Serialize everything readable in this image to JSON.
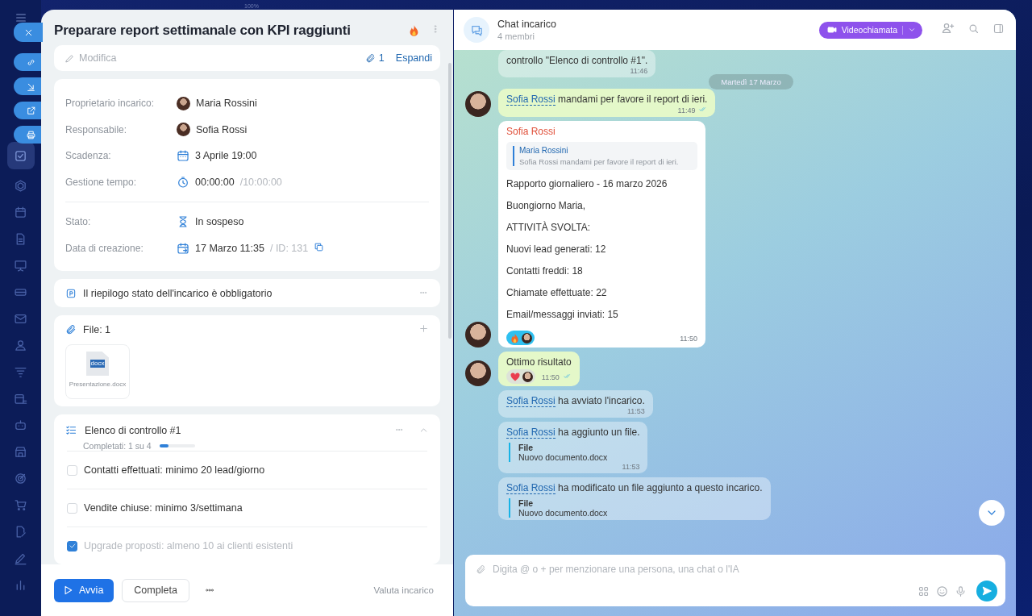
{
  "zoom_label": "100%",
  "sidebar_items": [
    {
      "kind": "tasks",
      "selected": true
    },
    {
      "kind": "hex",
      "selected": false
    },
    {
      "kind": "calendar",
      "selected": false
    },
    {
      "kind": "file",
      "selected": false
    },
    {
      "kind": "board",
      "selected": false
    },
    {
      "kind": "drive",
      "selected": false
    },
    {
      "kind": "mail",
      "selected": false
    },
    {
      "kind": "people",
      "selected": false
    },
    {
      "kind": "filter",
      "selected": false
    },
    {
      "kind": "planner",
      "selected": false
    },
    {
      "kind": "robot",
      "selected": false
    },
    {
      "kind": "store",
      "selected": false
    },
    {
      "kind": "target",
      "selected": false
    },
    {
      "kind": "cart",
      "selected": false
    },
    {
      "kind": "sign",
      "selected": false
    },
    {
      "kind": "pen",
      "selected": false
    },
    {
      "kind": "chart",
      "selected": false
    }
  ],
  "quick_actions": [
    {
      "kind": "close"
    },
    {
      "kind": "link"
    },
    {
      "kind": "download"
    },
    {
      "kind": "open"
    },
    {
      "kind": "print"
    }
  ],
  "task": {
    "title": "Preparare report settimanale con KPI raggiunti",
    "edit_label": "Modifica",
    "attachments_count": "1",
    "expand_label": "Espandi"
  },
  "details": {
    "primary": [
      {
        "kind": "person",
        "label": "Proprietario incarico:",
        "value": "Maria Rossini"
      },
      {
        "kind": "person",
        "label": "Responsabile:",
        "value": "Sofia Rossi"
      },
      {
        "kind": "date",
        "label": "Scadenza:",
        "value": "3 Aprile 19:00"
      },
      {
        "kind": "timer",
        "label": "Gestione tempo:",
        "value": "00:00:00",
        "extra": "/10:00:00"
      }
    ],
    "secondary": [
      {
        "kind": "status",
        "label": "Stato:",
        "value": "In sospeso"
      },
      {
        "kind": "created",
        "label": "Data di creazione:",
        "value": "17 Marzo 11:35",
        "extra": "/ ID: 131"
      }
    ]
  },
  "summary": {
    "text": "Il riepilogo stato dell'incarico è obbligatorio"
  },
  "files": {
    "title": "File: 1",
    "items": [
      {
        "name": "Presentazione.docx",
        "ext": "docx"
      }
    ]
  },
  "checklist": {
    "title": "Elenco di controllo #1",
    "progress_text": "Completati: 1 su 4",
    "level": 0.25,
    "expanded": true,
    "items": [
      {
        "text": "Contatti effettuati: minimo 20 lead/giorno",
        "checked": false
      },
      {
        "text": "Vendite chiuse: minimo 3/settimana",
        "checked": false
      },
      {
        "text": "Upgrade proposti: almeno 10 ai clienti esistenti",
        "checked": true
      }
    ]
  },
  "footer": {
    "start_label": "Avvia",
    "complete_label": "Completa",
    "rate_label": "Valuta incarico"
  },
  "chat": {
    "title": "Chat incarico",
    "subtitle": "4 membri",
    "video_label": "Videochiamata",
    "placeholder": "Digita @ o + per menzionare una persona, una chat o l'IA",
    "messages": [
      {
        "kind": "notice",
        "text": "controllo \"Elenco di controllo #1\".",
        "time": "11:46"
      },
      {
        "kind": "date",
        "text": "Martedì 17 Marzo"
      },
      {
        "kind": "own",
        "avatar": true,
        "mention": "Sofia Rossi",
        "text": "mandami per favore il report di ieri.",
        "time": "11:49",
        "read": true
      },
      {
        "kind": "incoming",
        "avatar": true,
        "author": "Sofia Rossi",
        "quote": {
          "author": "Maria Rossini",
          "text": "Sofia Rossi mandami per favore il report di ieri."
        },
        "lines": [
          "Rapporto giornaliero - 16 marzo 2026",
          "Buongiorno Maria,",
          "ATTIVITÀ SVOLTA:",
          "Nuovi lead generati: 12",
          "Contatti freddi: 18",
          "Chiamate effettuate: 22",
          "Email/messaggi inviati: 15"
        ],
        "reactions": [
          {
            "kind": "fire",
            "selected": true
          }
        ],
        "time": "11:50"
      },
      {
        "kind": "own",
        "avatar": true,
        "text": "Ottimo risultato",
        "reactions": [
          {
            "kind": "heart",
            "selected": false
          }
        ],
        "time": "11:50",
        "read": true
      },
      {
        "kind": "notice",
        "mention": "Sofia Rossi",
        "text": "ha avviato l'incarico.",
        "time": "11:53"
      },
      {
        "kind": "notice",
        "mention": "Sofia Rossi",
        "text": "ha aggiunto un file.",
        "file": {
          "title": "File",
          "name": "Nuovo documento.docx"
        },
        "time": "11:53"
      },
      {
        "kind": "notice",
        "mention": "Sofia Rossi",
        "text": "ha modificato un file aggiunto a questo incarico.",
        "file": {
          "title": "File",
          "name": "Nuovo documento.docx"
        }
      }
    ]
  }
}
